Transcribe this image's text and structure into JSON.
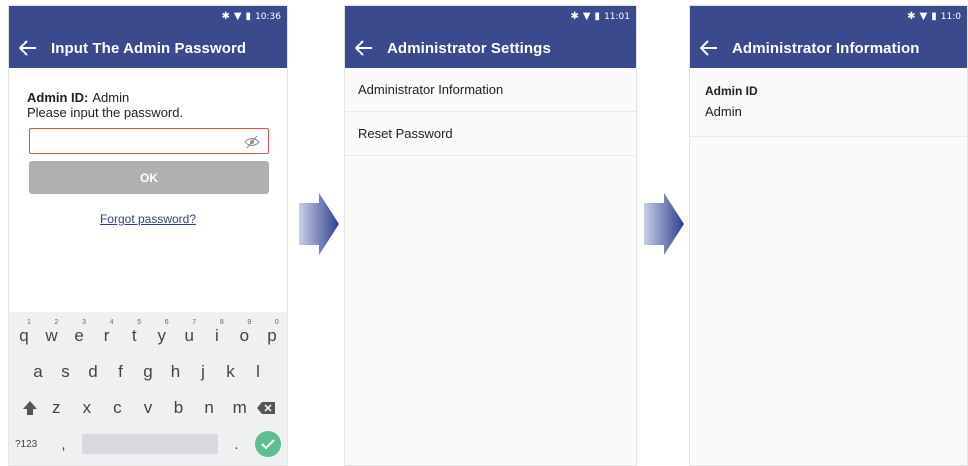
{
  "colors": {
    "appbar": "#3b4a8c",
    "accent_error": "#e05050",
    "button_disabled": "#b0b0b0",
    "link": "#2f3f90",
    "keyboard_enter": "#5dbf91"
  },
  "screen1": {
    "status_time": "10:36",
    "title": "Input The Admin Password",
    "admin_id_label": "Admin ID:",
    "admin_id_value": "Admin",
    "prompt": "Please input the password.",
    "password_value": "",
    "ok_label": "OK",
    "forgot_label": "Forgot password?",
    "keyboard": {
      "row1": [
        {
          "k": "q",
          "n": "1"
        },
        {
          "k": "w",
          "n": "2"
        },
        {
          "k": "e",
          "n": "3"
        },
        {
          "k": "r",
          "n": "4"
        },
        {
          "k": "t",
          "n": "5"
        },
        {
          "k": "y",
          "n": "6"
        },
        {
          "k": "u",
          "n": "7"
        },
        {
          "k": "i",
          "n": "8"
        },
        {
          "k": "o",
          "n": "9"
        },
        {
          "k": "p",
          "n": "0"
        }
      ],
      "row2": [
        "a",
        "s",
        "d",
        "f",
        "g",
        "h",
        "j",
        "k",
        "l"
      ],
      "row3": [
        "z",
        "x",
        "c",
        "v",
        "b",
        "n",
        "m"
      ],
      "sym_label": "?123",
      "comma": ",",
      "period": "."
    }
  },
  "screen2": {
    "status_time": "11:01",
    "title": "Administrator Settings",
    "items": [
      "Administrator Information",
      "Reset Password"
    ]
  },
  "screen3": {
    "status_time": "11:0",
    "title": "Administrator Information",
    "field_label": "Admin ID",
    "field_value": "Admin"
  },
  "icons": [
    "bluetooth-icon",
    "wifi-icon",
    "battery-icon",
    "back-arrow-icon",
    "eye-off-icon",
    "shift-icon",
    "backspace-icon",
    "check-icon",
    "flow-arrow-icon"
  ]
}
